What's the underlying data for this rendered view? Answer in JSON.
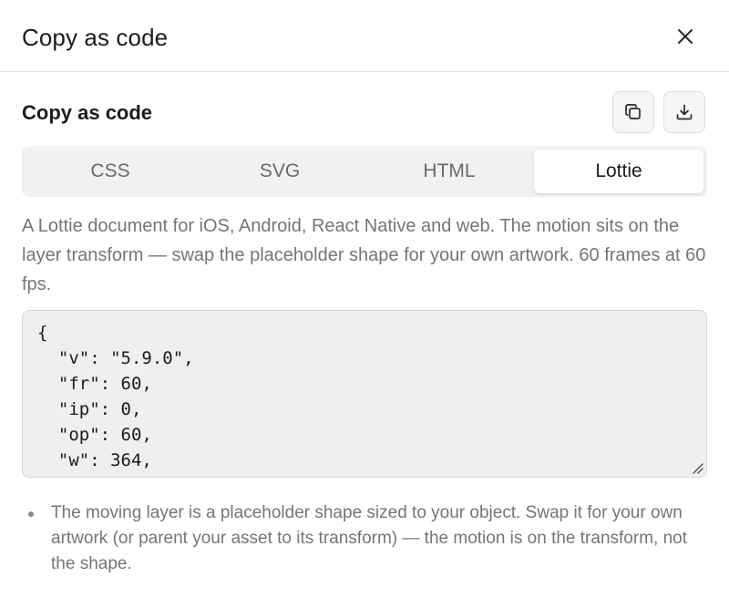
{
  "dialog": {
    "title": "Copy as code",
    "close_icon": "close-icon"
  },
  "section": {
    "title": "Copy as code",
    "copy_icon": "copy-icon",
    "download_icon": "download-icon"
  },
  "tabs": [
    {
      "label": "CSS",
      "active": false
    },
    {
      "label": "SVG",
      "active": false
    },
    {
      "label": "HTML",
      "active": false
    },
    {
      "label": "Lottie",
      "active": true
    }
  ],
  "description": "A Lottie document for iOS, Android, React Native and web. The motion sits on the layer transform — swap the placeholder shape for your own artwork. 60 frames at 60 fps.",
  "code": "{\n  \"v\": \"5.9.0\",\n  \"fr\": 60,\n  \"ip\": 0,\n  \"op\": 60,\n  \"w\": 364,",
  "notes": [
    "The moving layer is a placeholder shape sized to your object. Swap it for your own artwork (or parent your asset to its transform) — the motion is on the transform, not the shape."
  ],
  "colors": {
    "accent_text": "#1c1c1c",
    "muted_text": "#757575",
    "tab_bg": "#f1f1f1",
    "code_bg": "#efefef"
  }
}
